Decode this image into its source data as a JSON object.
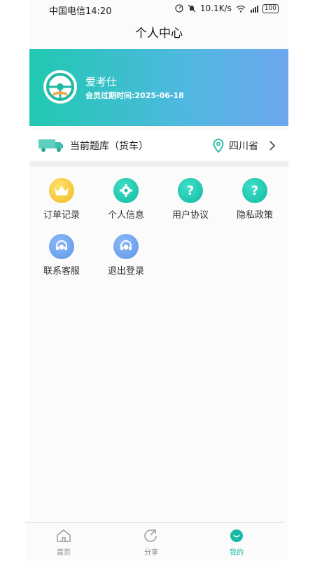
{
  "status_bar": {
    "carrier_time": "中国电信14:20",
    "net_speed": "10.1K/s",
    "battery": "100"
  },
  "title": "个人中心",
  "user": {
    "name": "爱考仕",
    "expire": "会员过期时间:2025-06-18"
  },
  "bank": {
    "label": "当前题库（货车）",
    "province": "四川省"
  },
  "menu": [
    {
      "label": "订单记录",
      "icon": "crown-icon"
    },
    {
      "label": "个人信息",
      "icon": "gear-icon"
    },
    {
      "label": "用户协议",
      "icon": "question-icon"
    },
    {
      "label": "隐私政策",
      "icon": "question-icon"
    },
    {
      "label": "联系客服",
      "icon": "headset-icon"
    },
    {
      "label": "退出登录",
      "icon": "headset-icon"
    }
  ],
  "tabs": [
    {
      "label": "首页",
      "icon": "home-icon"
    },
    {
      "label": "分享",
      "icon": "share-icon"
    },
    {
      "label": "我的",
      "icon": "profile-icon"
    }
  ],
  "colors": {
    "accent": "#18b9a5",
    "banner_start": "#20c9b1",
    "banner_end": "#6ea7ef"
  }
}
